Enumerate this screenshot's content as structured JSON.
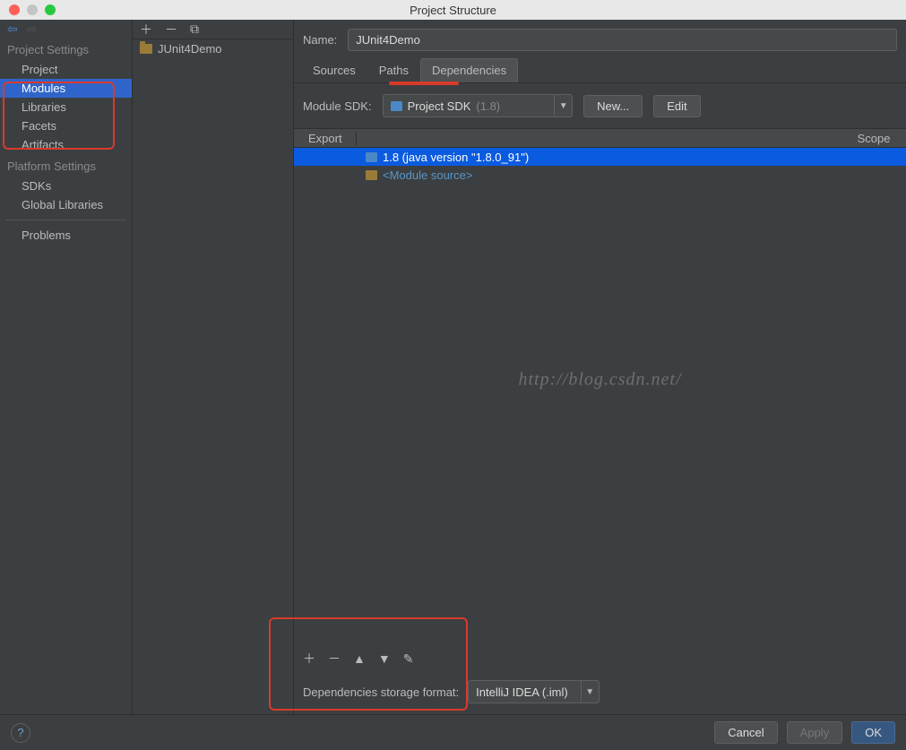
{
  "window": {
    "title": "Project Structure"
  },
  "sidebar": {
    "sections": [
      {
        "header": "Project Settings",
        "items": [
          {
            "label": "Project",
            "selected": false
          },
          {
            "label": "Modules",
            "selected": true
          },
          {
            "label": "Libraries",
            "selected": false
          },
          {
            "label": "Facets",
            "selected": false
          },
          {
            "label": "Artifacts",
            "selected": false
          }
        ]
      },
      {
        "header": "Platform Settings",
        "items": [
          {
            "label": "SDKs",
            "selected": false
          },
          {
            "label": "Global Libraries",
            "selected": false
          }
        ]
      },
      {
        "header": null,
        "items": [
          {
            "label": "Problems",
            "selected": false
          }
        ]
      }
    ]
  },
  "modules": {
    "items": [
      {
        "label": "JUnit4Demo"
      }
    ]
  },
  "detail": {
    "name_label": "Name:",
    "name_value": "JUnit4Demo",
    "tabs": [
      {
        "label": "Sources",
        "active": false
      },
      {
        "label": "Paths",
        "active": false
      },
      {
        "label": "Dependencies",
        "active": true
      }
    ],
    "module_sdk_label": "Module SDK:",
    "module_sdk_value": "Project SDK",
    "module_sdk_suffix": "(1.8)",
    "new_button": "New...",
    "edit_button": "Edit",
    "columns": {
      "export": "Export",
      "scope": "Scope"
    },
    "rows": [
      {
        "label": "1.8 (java version \"1.8.0_91\")",
        "selected": true,
        "kind": "sdk"
      },
      {
        "label": "<Module source>",
        "selected": false,
        "kind": "module-source"
      }
    ],
    "storage_label": "Dependencies storage format:",
    "storage_value": "IntelliJ IDEA (.iml)"
  },
  "footer": {
    "cancel": "Cancel",
    "apply": "Apply",
    "ok": "OK"
  },
  "watermark": "http://blog.csdn.net/"
}
